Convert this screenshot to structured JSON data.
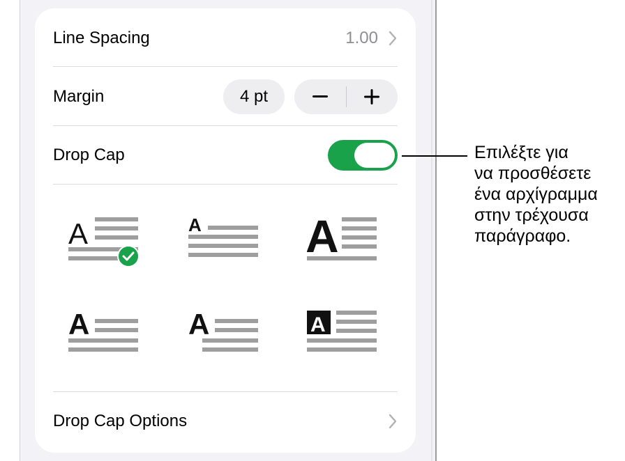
{
  "paragraph_panel": {
    "line_spacing": {
      "label": "Line Spacing",
      "value": "1.00"
    },
    "margin": {
      "label": "Margin",
      "value": "4 pt",
      "decrement": "−",
      "increment": "+"
    },
    "drop_cap": {
      "label": "Drop Cap",
      "enabled": true
    },
    "styles": [
      {
        "glyph": "A",
        "selected": true
      },
      {
        "glyph": "A",
        "selected": false
      },
      {
        "glyph": "A",
        "selected": false
      },
      {
        "glyph": "A",
        "selected": false
      },
      {
        "glyph": "A",
        "selected": false
      },
      {
        "glyph": "A",
        "selected": false
      }
    ],
    "drop_cap_options": {
      "label": "Drop Cap Options"
    }
  },
  "callout": {
    "lines": [
      "Επιλέξτε για",
      "να προσθέσετε",
      "ένα αρχίγραμμα",
      "στην τρέχουσα",
      "παράγραφο."
    ]
  },
  "colors": {
    "toggle_on": "#1aa24a",
    "selected_badge": "#1aa24a",
    "secondary_text": "#8e8e93"
  }
}
